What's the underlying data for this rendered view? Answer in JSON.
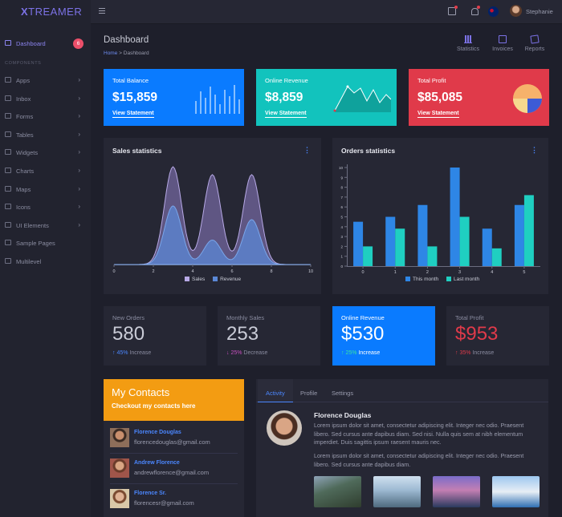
{
  "app": {
    "logo_first": "X",
    "logo_rest": "TREAMER",
    "user_name": "Stephanie"
  },
  "sidebar": {
    "dashboard_label": "Dashboard",
    "dashboard_badge": "6",
    "section_label": "COMPONENTS",
    "items": [
      {
        "label": "Apps",
        "icon": "grid-icon"
      },
      {
        "label": "Inbox",
        "icon": "inbox-icon"
      },
      {
        "label": "Forms",
        "icon": "forms-icon"
      },
      {
        "label": "Tables",
        "icon": "table-icon"
      },
      {
        "label": "Widgets",
        "icon": "widgets-icon"
      },
      {
        "label": "Charts",
        "icon": "chart-icon"
      },
      {
        "label": "Maps",
        "icon": "map-pin-icon"
      },
      {
        "label": "Icons",
        "icon": "icons-icon"
      },
      {
        "label": "UI Elements",
        "icon": "ui-elements-icon"
      },
      {
        "label": "Sample Pages",
        "icon": "pages-icon"
      },
      {
        "label": "Multilevel",
        "icon": "share-icon"
      }
    ]
  },
  "header": {
    "title": "Dashboard",
    "crumb_home": "Home",
    "crumb_sep": " > ",
    "crumb_current": "Dashboard",
    "actions": {
      "statistics": "Statistics",
      "invoices": "Invoices",
      "reports": "Reports"
    }
  },
  "cards": {
    "balance": {
      "title": "Total Balance",
      "value": "$15,859",
      "link": "View Statement",
      "color": "#0a7bff"
    },
    "revenue": {
      "title": "Online Revenue",
      "value": "$8,859",
      "link": "View Statement",
      "color": "#12c3bd"
    },
    "profit": {
      "title": "Total Profit",
      "value": "$85,085",
      "link": "View Statement",
      "color": "#e03a4a"
    }
  },
  "sales": {
    "title": "Sales statistics",
    "legend_sales": "Sales",
    "legend_revenue": "Revenue"
  },
  "orders": {
    "title": "Orders statistics",
    "legend_this": "This month",
    "legend_last": "Last month"
  },
  "chart_data": [
    {
      "type": "area",
      "title": "Sales statistics",
      "x_ticks": [
        "0",
        "2",
        "4",
        "6",
        "8",
        "10"
      ],
      "xlim": [
        0,
        10
      ],
      "series": [
        {
          "name": "Sales",
          "color": "#8e7ec4",
          "peaks": [
            {
              "x": 3,
              "y": 100
            },
            {
              "x": 5,
              "y": 92
            },
            {
              "x": 7,
              "y": 92
            }
          ]
        },
        {
          "name": "Revenue",
          "color": "#5b88d6",
          "peaks": [
            {
              "x": 3,
              "y": 60
            },
            {
              "x": 5,
              "y": 25
            },
            {
              "x": 7,
              "y": 46
            }
          ]
        }
      ]
    },
    {
      "type": "bar",
      "title": "Orders statistics",
      "categories": [
        "0",
        "1",
        "2",
        "3",
        "4",
        "5"
      ],
      "y_ticks": [
        "0",
        "1",
        "2",
        "3",
        "4",
        "5",
        "6",
        "7",
        "8",
        "9",
        "10"
      ],
      "ylim": [
        0,
        10
      ],
      "series": [
        {
          "name": "This month",
          "color": "#2e86e6",
          "values": [
            4.5,
            5,
            6.2,
            10,
            3.8,
            6.2
          ]
        },
        {
          "name": "Last month",
          "color": "#1fcfc1",
          "values": [
            2,
            3.8,
            2,
            5,
            1.8,
            7.2
          ]
        }
      ]
    }
  ],
  "mini_stats": [
    {
      "title": "New Orders",
      "value": "580",
      "change": "45%",
      "word": "Increase",
      "dir": "up"
    },
    {
      "title": "Monthly Sales",
      "value": "253",
      "change": "25%",
      "word": "Decrease",
      "dir": "down"
    },
    {
      "title": "Online Revenue",
      "value": "$530",
      "change": "25%",
      "word": "Increase",
      "dir": "up"
    },
    {
      "title": "Total Profit",
      "value": "$953",
      "change": "35%",
      "word": "Increase",
      "dir": "up"
    }
  ],
  "contacts": {
    "title": "My Contacts",
    "subtitle": "Checkout my contacts here",
    "list": [
      {
        "name": "Florence Douglas",
        "email": "florencedouglas@gmail.com"
      },
      {
        "name": "Andrew Florence",
        "email": "andrewflorence@gmail.com"
      },
      {
        "name": "Florence Sr.",
        "email": "florencesr@gmail.com"
      }
    ]
  },
  "profile": {
    "tabs": [
      "Activity",
      "Profile",
      "Settings"
    ],
    "name": "Florence Douglas",
    "para1": "Lorem ipsum dolor sit amet, consectetur adipiscing elit. Integer nec odio. Praesent libero. Sed cursus ante dapibus diam. Sed nisi. Nulla quis sem at nibh elementum imperdiet. Duis sagittis ipsum raesent mauris nec.",
    "para2": "Lorem ipsum dolor sit amet, consectetur adipiscing elit. Integer nec odio. Praesent libero. Sed cursus ante dapibus diam."
  }
}
